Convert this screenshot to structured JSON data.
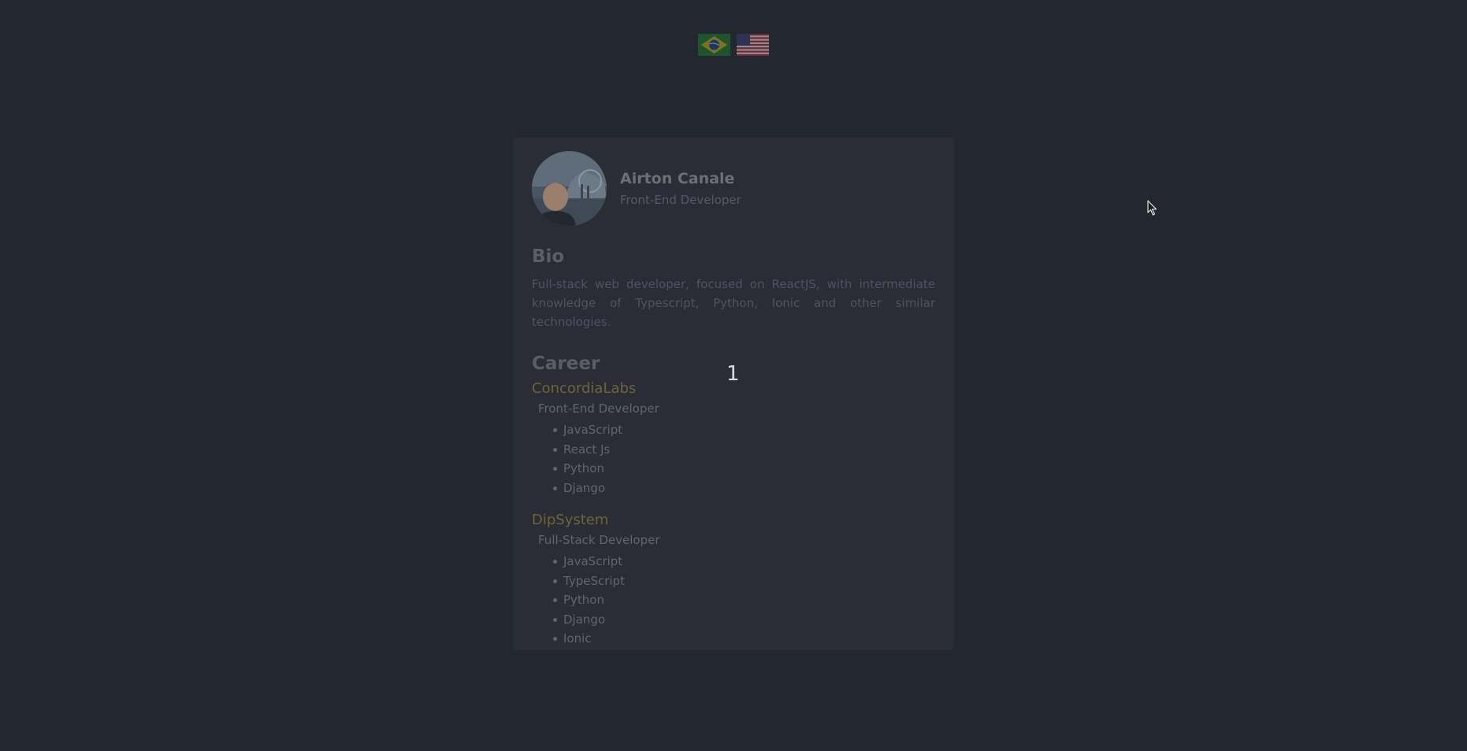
{
  "languages": [
    {
      "name": "Português",
      "icon": "brazil-flag-icon"
    },
    {
      "name": "English",
      "icon": "usa-flag-icon"
    }
  ],
  "profile": {
    "name": "Airton Canale",
    "title": "Front-End Developer",
    "avatar_icon": "profile-photo"
  },
  "bio": {
    "heading": "Bio",
    "text": "Full-stack web developer, focused on ReactJS, with intermediate knowledge of Typescript, Python, Ionic and other similar technologies."
  },
  "career": {
    "heading": "Career",
    "jobs": [
      {
        "company": "ConcordiaLabs",
        "role": "Front-End Developer",
        "skills": [
          "JavaScript",
          "React Js",
          "Python",
          "Django"
        ]
      },
      {
        "company": "DipSystem",
        "role": "Full-Stack Developer",
        "skills": [
          "JavaScript",
          "TypeScript",
          "Python",
          "Django",
          "Ionic"
        ]
      }
    ]
  },
  "overlay": {
    "counter": "1"
  },
  "colors": {
    "background": "#23272f",
    "card": "#2a2d35",
    "company_accent": "#6e6436"
  }
}
